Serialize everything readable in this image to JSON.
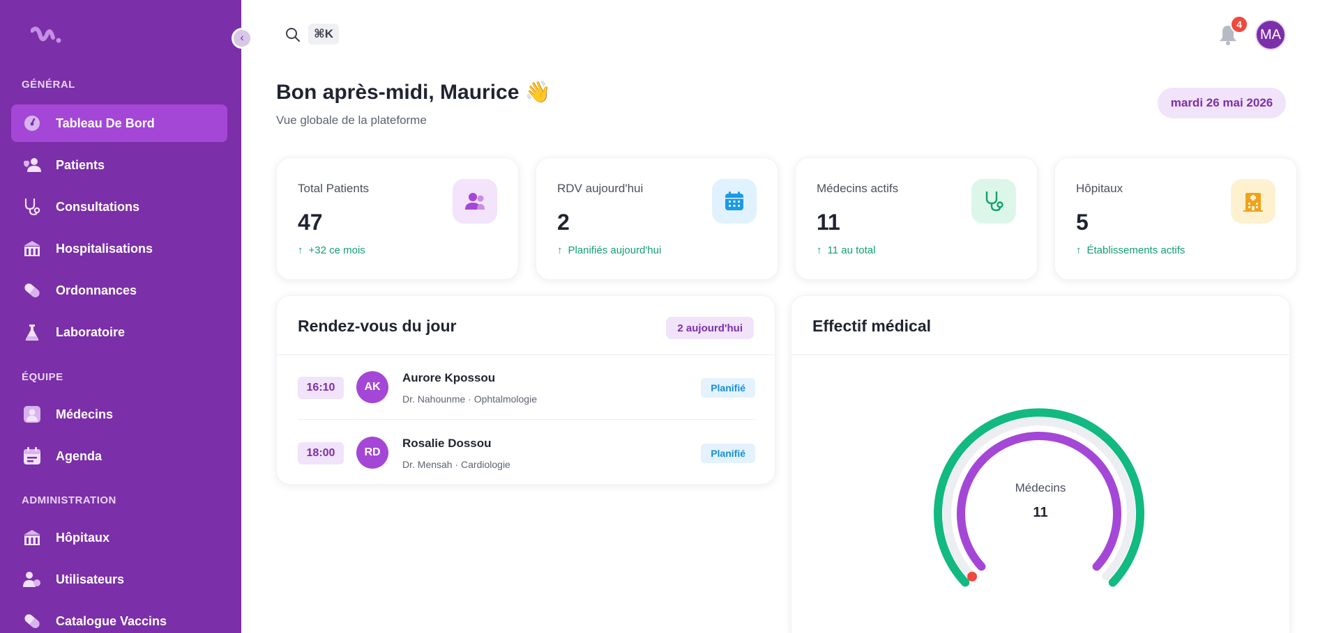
{
  "sidebar": {
    "sections": {
      "general": "GÉNÉRAL",
      "equipe": "ÉQUIPE",
      "administration": "ADMINISTRATION"
    },
    "items": {
      "dashboard": "Tableau De Bord",
      "patients": "Patients",
      "consultations": "Consultations",
      "hospitalisations": "Hospitalisations",
      "ordonnances": "Ordonnances",
      "laboratoire": "Laboratoire",
      "medecins": "Médecins",
      "agenda": "Agenda",
      "hopitaux": "Hôpitaux",
      "utilisateurs": "Utilisateurs",
      "vaccins": "Catalogue Vaccins"
    },
    "active_item": "dashboard"
  },
  "topbar": {
    "search_shortcut": "⌘K",
    "notifications_count": "4",
    "user_initials": "MA"
  },
  "header": {
    "greeting": "Bon après-midi, Maurice 👋",
    "subtitle": "Vue globale de la plateforme",
    "date": "mardi 26 mai 2026"
  },
  "stats": [
    {
      "label": "Total Patients",
      "value": "47",
      "trend": "+32 ce mois",
      "icon": "patients-icon",
      "color": "#a447d6"
    },
    {
      "label": "RDV aujourd'hui",
      "value": "2",
      "trend": "Planifiés aujourd'hui",
      "icon": "calendar-icon",
      "color": "#1a9be6"
    },
    {
      "label": "Médecins actifs",
      "value": "11",
      "trend": "11 au total",
      "icon": "stethoscope-icon",
      "color": "#12a06e"
    },
    {
      "label": "Hôpitaux",
      "value": "5",
      "trend": "Établissements actifs",
      "icon": "hospital-icon",
      "color": "#f0a21a"
    }
  ],
  "appointments": {
    "title": "Rendez-vous du jour",
    "badge": "2 aujourd'hui",
    "rows": [
      {
        "time": "16:10",
        "initials": "AK",
        "name": "Aurore Kpossou",
        "meta": "Dr. Nahounme · Ophtalmologie",
        "status": "Planifié"
      },
      {
        "time": "18:00",
        "initials": "RD",
        "name": "Rosalie Dossou",
        "meta": "Dr. Mensah · Cardiologie",
        "status": "Planifié"
      }
    ]
  },
  "effectif": {
    "title": "Effectif médical",
    "gauge_label": "Médecins",
    "gauge_value": "11"
  },
  "colors": {
    "sidebar": "#7b2fa8",
    "active": "#a447d6",
    "green": "#12a06e",
    "badge_red": "#f0483e"
  }
}
